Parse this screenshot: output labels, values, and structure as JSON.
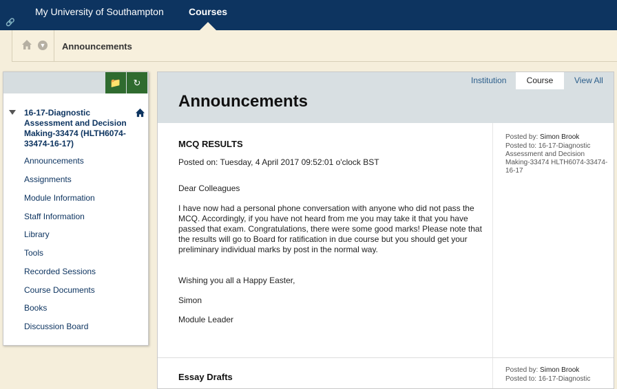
{
  "topnav": {
    "university": "My University of Southampton",
    "courses": "Courses"
  },
  "breadcrumb": {
    "title": "Announcements"
  },
  "sidebar": {
    "course_title": "16-17-Diagnostic Assessment and Decision Making-33474 (HLTH6074-33474-16-17)",
    "items": [
      "Announcements",
      "Assignments",
      "Module Information",
      "Staff Information",
      "Library",
      "Tools",
      "Recorded Sessions",
      "Course Documents",
      "Books",
      "Discussion Board"
    ]
  },
  "main": {
    "tabs": [
      "Institution",
      "Course",
      "View All"
    ],
    "title": "Announcements",
    "announcements": [
      {
        "title": "MCQ RESULTS",
        "posted_on": "Posted on: Tuesday, 4 April 2017 09:52:01 o'clock BST",
        "posted_by_label": "Posted by:",
        "posted_by": "Simon Brook",
        "posted_to_label": "Posted to:",
        "posted_to": "16-17-Diagnostic Assessment and Decision Making-33474 HLTH6074-33474-16-17",
        "body": [
          "Dear Colleagues",
          "I have now had a personal phone conversation with anyone who did not pass the MCQ. Accordingly, if you have not heard from me you may take it that you have passed that exam. Congratulations, there were some good marks! Please note that the results will go to Board for ratification in due course but you should get your preliminary individual marks by post in the normal way.",
          "Wishing you all a Happy Easter,",
          "Simon",
          "Module Leader"
        ]
      },
      {
        "title": "Essay Drafts",
        "posted_by_label": "Posted by:",
        "posted_by": "Simon Brook",
        "posted_to_label": "Posted to:",
        "posted_to": "16-17-Diagnostic"
      }
    ]
  }
}
